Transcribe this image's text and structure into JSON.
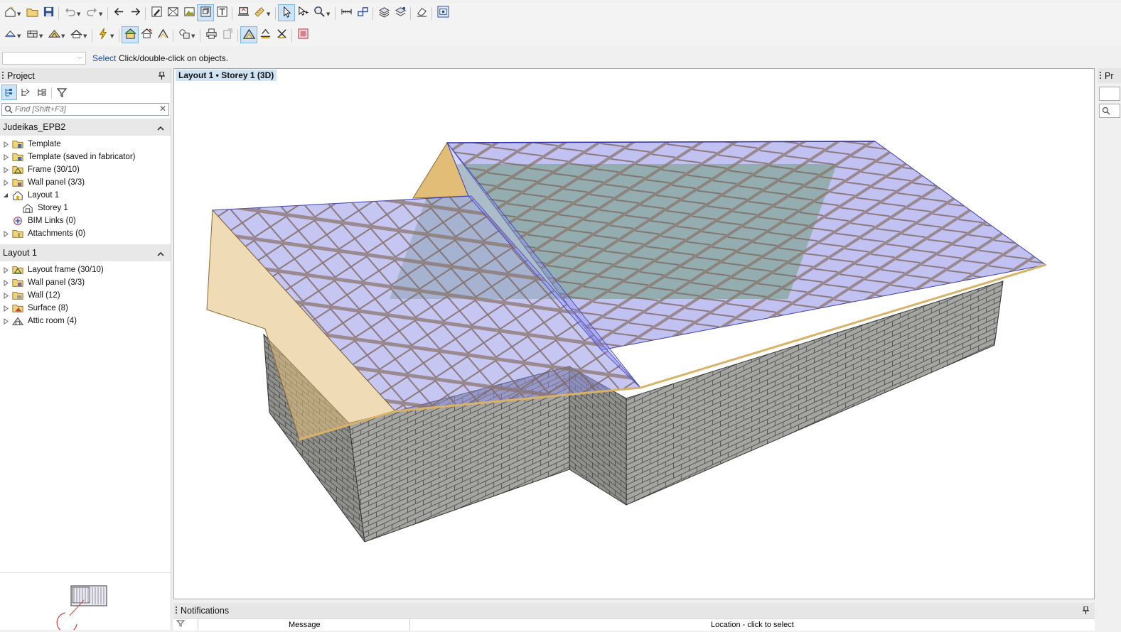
{
  "toolbar1": [
    {
      "name": "new-model-button",
      "icon": "new-house-icon",
      "dropdown": true
    },
    {
      "name": "open-button",
      "icon": "open-folder-icon"
    },
    {
      "name": "save-button",
      "icon": "floppy-disk-icon"
    },
    {
      "name": "undo-button",
      "icon": "undo-icon",
      "dropdown": true
    },
    {
      "name": "redo-button",
      "icon": "redo-icon",
      "dropdown": true
    },
    {
      "name": "back-button",
      "icon": "arrow-left-icon"
    },
    {
      "name": "forward-button",
      "icon": "arrow-right-icon"
    },
    {
      "name": "edit-button",
      "icon": "pencil-icon"
    },
    {
      "name": "wireframe-button",
      "icon": "envelope-icon"
    },
    {
      "name": "terrain-button",
      "icon": "mountain-icon"
    },
    {
      "name": "view-3d-button",
      "icon": "cube-icon",
      "active": true
    },
    {
      "name": "text-button",
      "icon": "text-icon"
    },
    {
      "name": "display-button",
      "icon": "monitor-icon"
    },
    {
      "name": "measure-tool-button",
      "icon": "ruler-pencil-icon",
      "dropdown": true
    },
    {
      "name": "select-tool-button",
      "icon": "cursor-arrow-icon",
      "active": true
    },
    {
      "name": "move-tool-button",
      "icon": "move-cursor-icon"
    },
    {
      "name": "zoom-button",
      "icon": "magnifier-icon",
      "dropdown": true
    },
    {
      "name": "dimension-button",
      "icon": "dimension-icon"
    },
    {
      "name": "link-button",
      "icon": "link-icon"
    },
    {
      "name": "layers-button",
      "icon": "layers-icon"
    },
    {
      "name": "layers-settings-button",
      "icon": "layers-gear-icon"
    },
    {
      "name": "eraser-button",
      "icon": "eraser-icon"
    },
    {
      "name": "screenshot-button",
      "icon": "camera-icon"
    }
  ],
  "toolbar2": [
    {
      "name": "frame-tools-button",
      "icon": "frame-icon",
      "dropdown": true
    },
    {
      "name": "wall-tools-button",
      "icon": "wall-icon",
      "dropdown": true
    },
    {
      "name": "truss-tools-button",
      "icon": "truss-icon",
      "dropdown": true
    },
    {
      "name": "roof-tools-button",
      "icon": "roof-icon",
      "dropdown": true
    },
    {
      "name": "lightning-button",
      "icon": "lightning-icon",
      "dropdown": true
    },
    {
      "name": "roof-plane-button",
      "icon": "roof-plane-icon",
      "active": true
    },
    {
      "name": "roof-edit-button",
      "icon": "roof-edit-icon"
    },
    {
      "name": "truss-edit-button",
      "icon": "truss-edit-icon"
    },
    {
      "name": "group-button",
      "icon": "group-icon",
      "dropdown": true
    },
    {
      "name": "print-button",
      "icon": "printer-icon"
    },
    {
      "name": "export-button",
      "icon": "export-icon"
    },
    {
      "name": "truss-view-button",
      "icon": "truss-view-icon",
      "active": true
    },
    {
      "name": "member-button",
      "icon": "member-icon"
    },
    {
      "name": "cross-button",
      "icon": "cross-member-icon"
    },
    {
      "name": "render-button",
      "icon": "render-box-icon"
    }
  ],
  "command": {
    "name": "Select",
    "hint": "Click/double-click on objects."
  },
  "project_panel": {
    "title": "Project",
    "search_placeholder": "Find [Shift+F3]",
    "section1_title": "Judeikas_EPB2",
    "tree1": [
      {
        "label": "Template",
        "icon": "template-folder-icon",
        "expand": "closed",
        "indent": 0
      },
      {
        "label": "Template (saved in fabricator)",
        "icon": "template-folder-icon",
        "expand": "closed",
        "indent": 0
      },
      {
        "label": "Frame (30/10)",
        "icon": "frame-folder-icon",
        "expand": "closed",
        "indent": 0
      },
      {
        "label": "Wall panel (3/3)",
        "icon": "wall-panel-folder-icon",
        "expand": "closed",
        "indent": 0
      },
      {
        "label": "Layout 1",
        "icon": "layout-house-icon",
        "expand": "open",
        "indent": 0
      },
      {
        "label": "Storey 1",
        "icon": "storey-house-icon",
        "expand": "none",
        "indent": 1
      },
      {
        "label": "BIM Links (0)",
        "icon": "bim-link-icon",
        "expand": "none",
        "indent": 0
      },
      {
        "label": "Attachments (0)",
        "icon": "attachment-folder-icon",
        "expand": "closed",
        "indent": 0
      }
    ],
    "section2_title": "Layout 1",
    "tree2": [
      {
        "label": "Layout frame (30/10)",
        "icon": "frame-folder-icon",
        "expand": "closed"
      },
      {
        "label": "Wall panel (3/3)",
        "icon": "wall-panel-folder-icon",
        "expand": "closed"
      },
      {
        "label": "Wall (12)",
        "icon": "wall-folder-icon",
        "expand": "closed"
      },
      {
        "label": "Surface (8)",
        "icon": "surface-folder-icon",
        "expand": "closed"
      },
      {
        "label": "Attic room (4)",
        "icon": "attic-room-icon",
        "expand": "closed"
      }
    ]
  },
  "viewport": {
    "label": "Layout 1 • Storey 1 (3D)"
  },
  "right_panel": {
    "title": "Pr"
  },
  "notifications": {
    "title": "Notifications",
    "col_message": "Message",
    "col_location": "Location - click to select"
  },
  "colors": {
    "truss": "#8a7268",
    "roof_glass": "#8e8ee8",
    "wall_brick": "#a3a3a0",
    "gable_wood": "#e2bd78",
    "highlight": "#cde3f7",
    "inner_frame": "#3f8a36"
  }
}
